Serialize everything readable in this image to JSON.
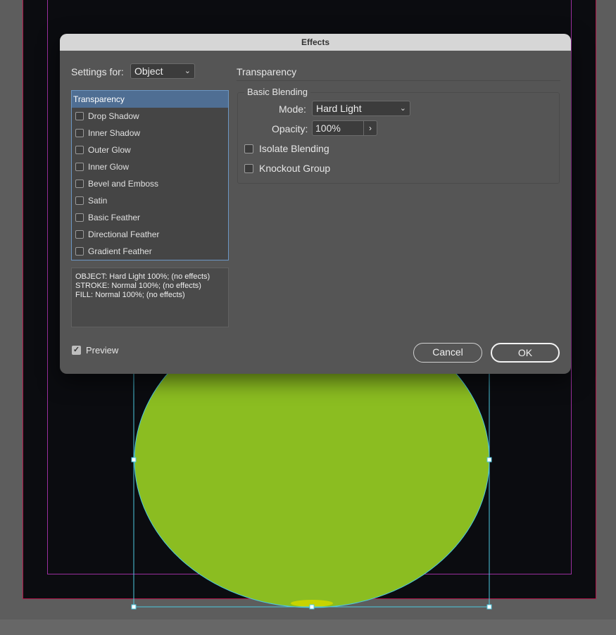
{
  "dialog": {
    "title": "Effects",
    "settings_for_label": "Settings for:",
    "settings_for_value": "Object",
    "effects": [
      {
        "label": "Transparency",
        "selected": true
      },
      {
        "label": "Drop Shadow",
        "checked": false
      },
      {
        "label": "Inner Shadow",
        "checked": false
      },
      {
        "label": "Outer Glow",
        "checked": false
      },
      {
        "label": "Inner Glow",
        "checked": false
      },
      {
        "label": "Bevel and Emboss",
        "checked": false
      },
      {
        "label": "Satin",
        "checked": false
      },
      {
        "label": "Basic Feather",
        "checked": false
      },
      {
        "label": "Directional Feather",
        "checked": false
      },
      {
        "label": "Gradient Feather",
        "checked": false
      }
    ],
    "summary": [
      "OBJECT: Hard Light 100%; (no effects)",
      "STROKE: Normal 100%; (no effects)",
      "FILL: Normal 100%; (no effects)"
    ],
    "preview_label": "Preview",
    "preview_checked": true,
    "cancel_label": "Cancel",
    "ok_label": "OK"
  },
  "panel": {
    "title": "Transparency",
    "group_title": "Basic Blending",
    "mode_label": "Mode:",
    "mode_value": "Hard Light",
    "opacity_label": "Opacity:",
    "opacity_value": "100%",
    "isolate_label": "Isolate Blending",
    "isolate_checked": false,
    "knockout_label": "Knockout Group",
    "knockout_checked": false
  },
  "canvas": {
    "ellipse_fill": "#8bbd21",
    "page_color": "#0b0c10",
    "bleed_color": "#b0174a",
    "margin_color": "#9b2f9e",
    "selection_color": "#4cc9e0"
  },
  "icons": {
    "dropdown": "chevron-down-icon",
    "stepper": "chevron-right-icon",
    "check": "checkmark-icon"
  }
}
